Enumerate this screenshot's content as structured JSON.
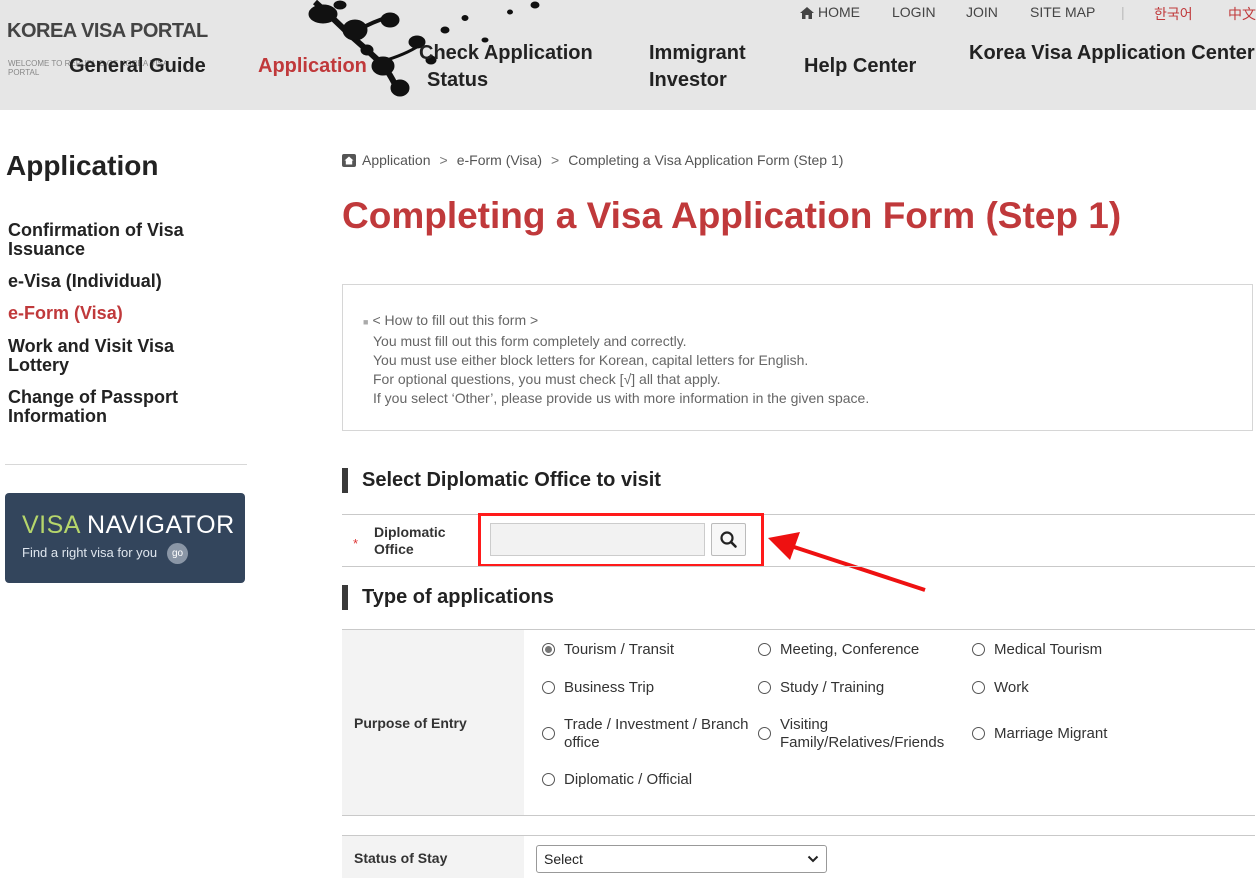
{
  "header": {
    "logo_title": "KOREA VISA PORTAL",
    "logo_subtitle": "WELCOME TO REPUBLIC OF KOREA VISA PORTAL",
    "top_links": {
      "home": "HOME",
      "login": "LOGIN",
      "join": "JOIN",
      "site_map": "SITE MAP",
      "lang_korean": "한국어",
      "lang_chinese": "中文"
    },
    "nav": {
      "general_guide": "General Guide",
      "application": "Application",
      "check_application_status_1": "Check Application",
      "check_application_status_2": "Status",
      "immigrant_investor_1": "Immigrant",
      "immigrant_investor_2": "Investor",
      "help_center": "Help Center",
      "visa_center": "Korea Visa Application Center"
    }
  },
  "sidebar": {
    "title": "Application",
    "items": [
      {
        "line1": "Confirmation of Visa",
        "line2": "Issuance"
      },
      {
        "line1": "e-Visa (Individual)",
        "line2": ""
      },
      {
        "line1": "e-Form (Visa)",
        "line2": ""
      },
      {
        "line1": "Work and Visit Visa",
        "line2": "Lottery"
      },
      {
        "line1": "Change of Passport",
        "line2": "Information"
      }
    ],
    "navigator": {
      "word1": "VISA",
      "word2": " NAVIGATOR",
      "subtitle": "Find a right visa for you",
      "go": "go"
    }
  },
  "breadcrumb": {
    "items": [
      "Application",
      "e-Form (Visa)",
      "Completing a Visa Application Form (Step 1)"
    ],
    "separator": ">"
  },
  "page_title": "Completing a Visa Application Form (Step 1)",
  "instructions": {
    "heading": "< How to fill out this form >",
    "lines": [
      "You must fill out this form completely and correctly.",
      "You must use either block letters for Korean, capital letters for English.",
      "For optional questions, you must check [√] all that apply.",
      "If you select ‘Other’, please provide us with more information in the given space."
    ]
  },
  "diplomatic_section": {
    "heading": "Select Diplomatic Office to visit",
    "required_mark": "*",
    "label_1": "Diplomatic",
    "label_2": "Office",
    "value": ""
  },
  "type_section": {
    "heading": "Type of applications",
    "purpose_label": "Purpose of Entry",
    "options": [
      {
        "label": "Tourism / Transit",
        "label2": "",
        "checked": true
      },
      {
        "label": "Meeting, Conference",
        "label2": "",
        "checked": false
      },
      {
        "label": "Medical Tourism",
        "label2": "",
        "checked": false
      },
      {
        "label": "Business Trip",
        "label2": "",
        "checked": false
      },
      {
        "label": "Study / Training",
        "label2": "",
        "checked": false
      },
      {
        "label": "Work",
        "label2": "",
        "checked": false
      },
      {
        "label": "Trade / Investment / Branch",
        "label2": "office",
        "checked": false
      },
      {
        "label": "Visiting",
        "label2": "Family/Relatives/Friends",
        "checked": false
      },
      {
        "label": "Marriage Migrant",
        "label2": "",
        "checked": false
      },
      {
        "label": "Diplomatic / Official",
        "label2": "",
        "checked": false
      }
    ],
    "status_label": "Status of Stay",
    "status_select": "Select"
  },
  "colors": {
    "accent": "#c0393b",
    "highlight_box": "#ff1a1a",
    "header_bg": "#e6e6e6",
    "navigator_bg": "#33455c"
  },
  "icons": {
    "home": "home-icon",
    "search": "search-icon",
    "annotation_arrow": "red-arrow-icon"
  }
}
